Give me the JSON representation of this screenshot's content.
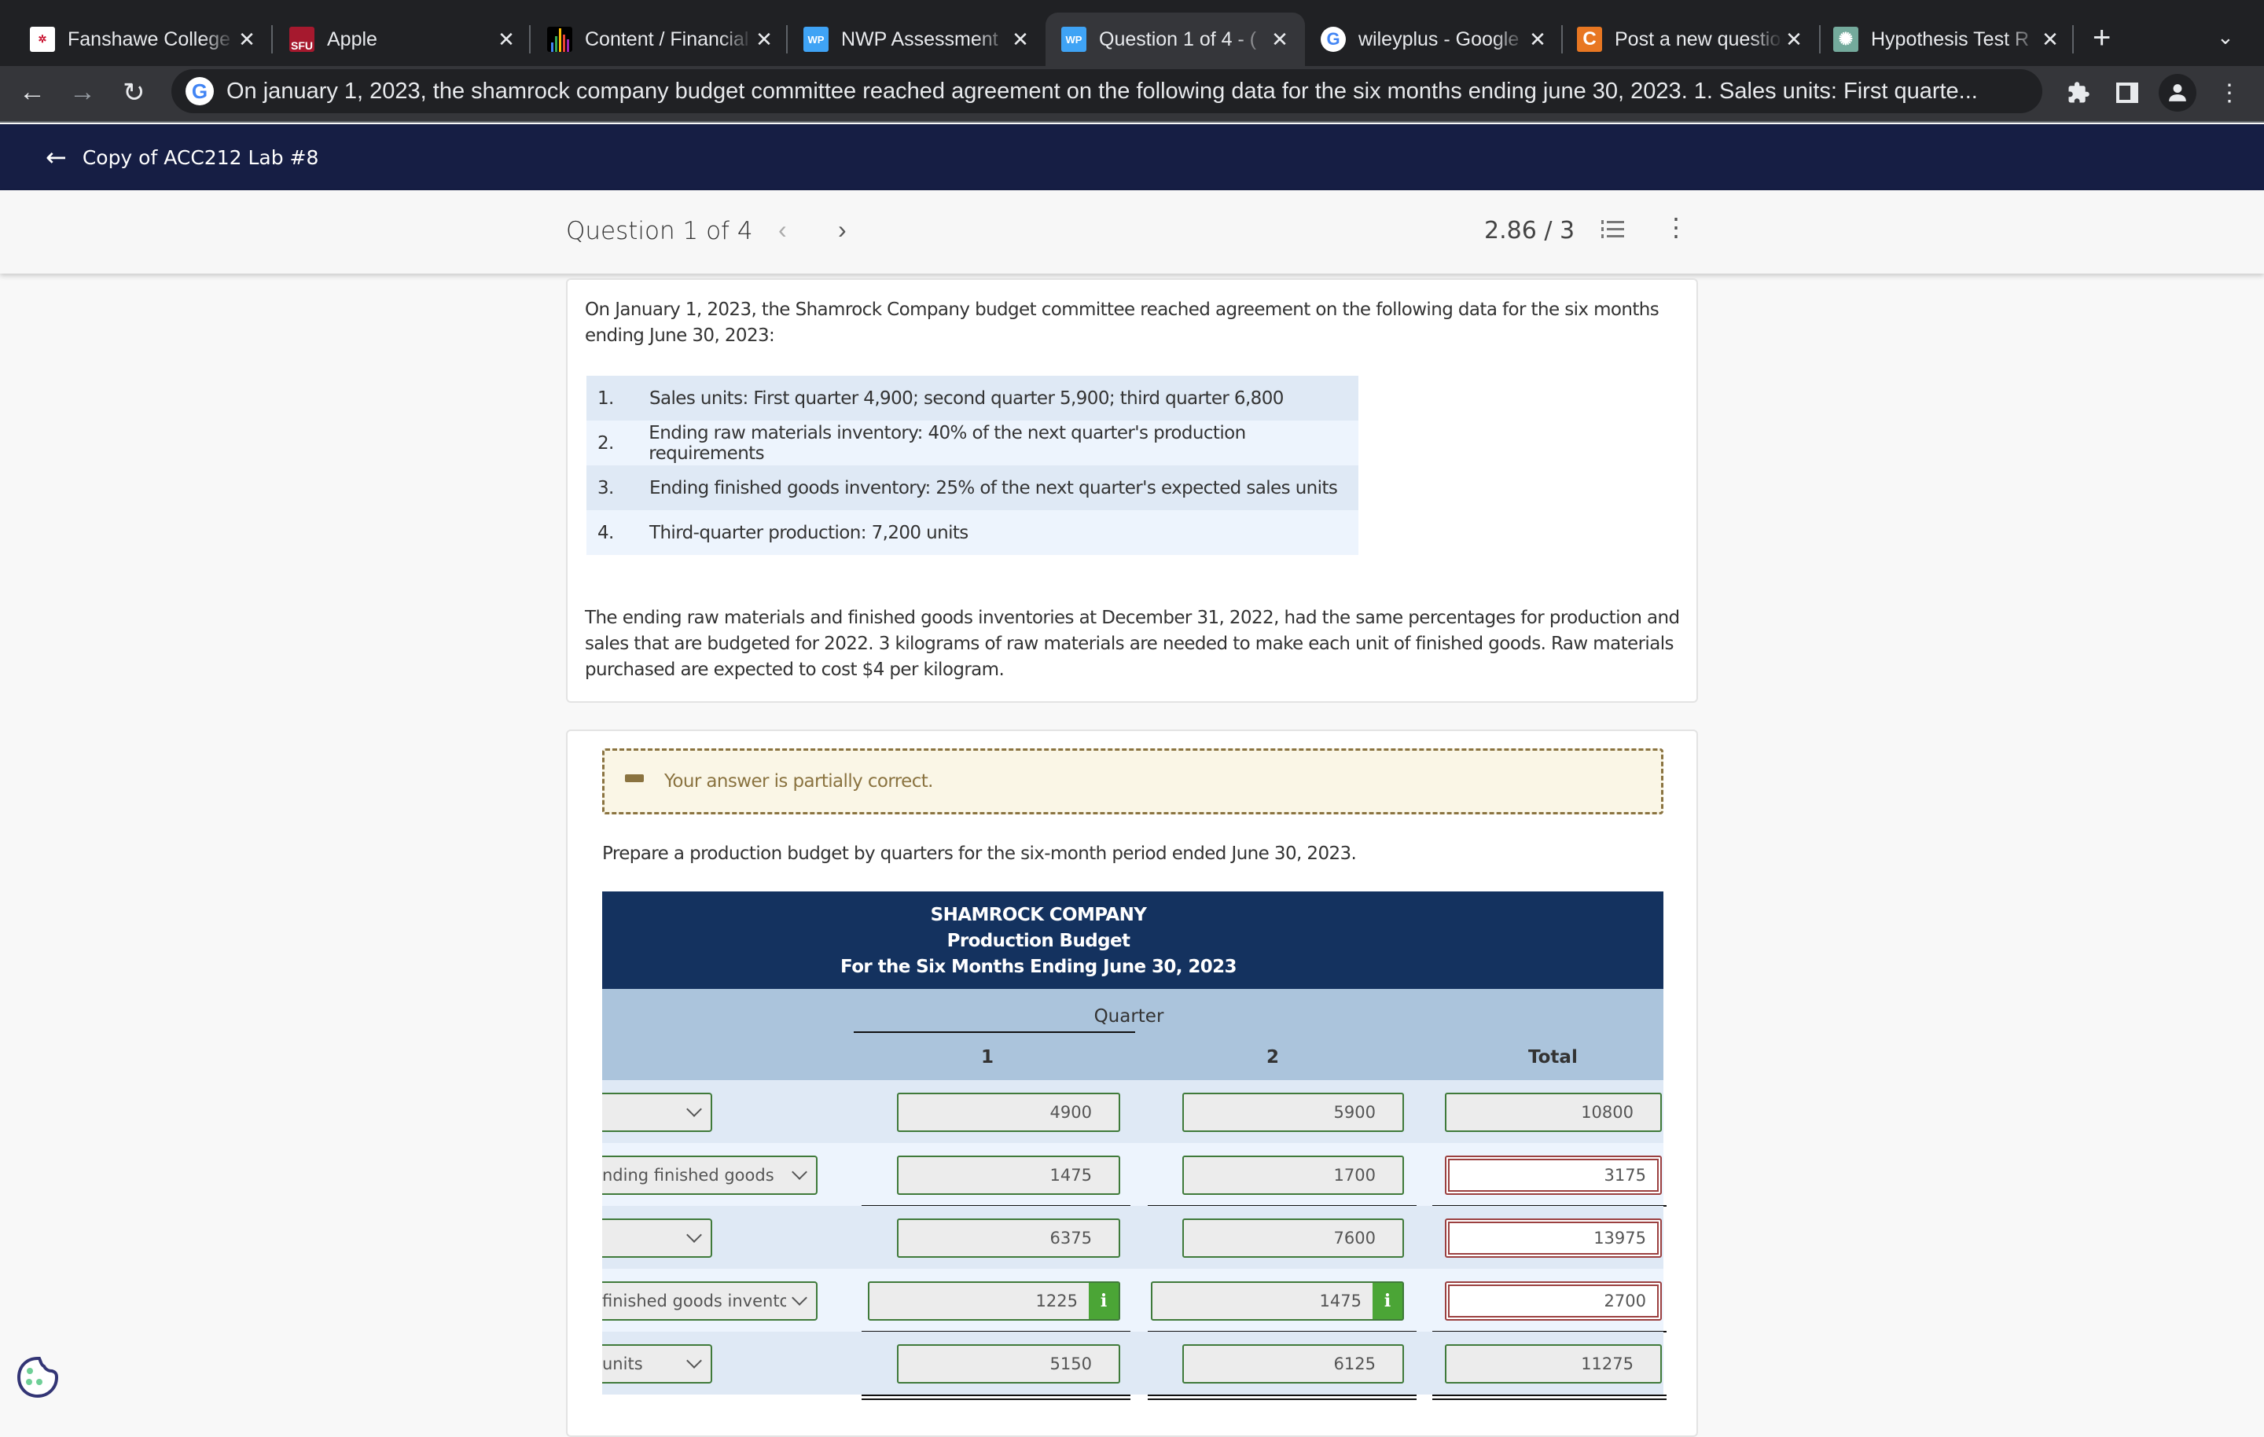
{
  "browser": {
    "tabs": [
      {
        "label": "Fanshawe College",
        "icon": "fanshawe-logo-icon",
        "color": "#c8102e"
      },
      {
        "label": "Apple",
        "icon": "sfu-logo-icon",
        "color": "#a6192e"
      },
      {
        "label": "Content / Financial",
        "icon": "bar-chart-icon",
        "color": "#000000"
      },
      {
        "label": "NWP Assessment",
        "icon": "wp-logo-icon",
        "color": "#3fa3f5"
      },
      {
        "label": "Question 1 of 4 - (",
        "icon": "wp-logo-icon",
        "color": "#3fa3f5",
        "active": true
      },
      {
        "label": "wileyplus - Google",
        "icon": "google-icon",
        "color": "#ffffff"
      },
      {
        "label": "Post a new question",
        "icon": "chegg-icon",
        "color": "#e87722"
      },
      {
        "label": "Hypothesis Test R",
        "icon": "openai-icon",
        "color": "#74aa9c"
      }
    ],
    "new_tab": "+",
    "tab_list": "⌄",
    "back": "←",
    "forward": "→",
    "reload": "C",
    "address": "On january 1, 2023, the shamrock company budget committee reached agreement on the following data for the six months ending june 30, 2023. 1. Sales units: First quarte..."
  },
  "app": {
    "back_label": "Copy of ACC212 Lab #8",
    "question_title": "Question 1 of 4",
    "prev": "‹",
    "next": "›",
    "score": "2.86 / 3",
    "menu": "⋮"
  },
  "problem": {
    "intro": "On January 1, 2023, the Shamrock Company budget committee reached agreement on the following data for the six months ending June 30, 2023:",
    "conditions": [
      {
        "num": "1.",
        "text": "Sales units: First quarter 4,900; second quarter 5,900; third quarter 6,800"
      },
      {
        "num": "2.",
        "text": "Ending raw materials inventory: 40% of the next quarter's production requirements"
      },
      {
        "num": "3.",
        "text": "Ending finished goods inventory: 25% of the next quarter's expected sales units"
      },
      {
        "num": "4.",
        "text": "Third-quarter production: 7,200 units"
      }
    ],
    "notes": "The ending raw materials and finished goods inventories at December 31, 2022, had the same percentages for production and sales that are budgeted for 2022. 3 kilograms of raw materials are needed to make each unit of finished goods. Raw materials purchased are expected to cost $4 per kilogram."
  },
  "answer": {
    "feedback": "Your answer is partially correct.",
    "feedback_color": "#8a7340",
    "instruction": "Prepare a production budget by quarters for the six-month period ended June 30, 2023.",
    "table": {
      "company": "SHAMROCK COMPANY",
      "statement": "Production Budget",
      "period": "For the Six Months Ending June 30, 2023",
      "quarter_label": "Quarter",
      "columns": [
        "1",
        "2",
        "Total"
      ],
      "rows": [
        {
          "label": "",
          "q1": "4900",
          "q2": "5900",
          "total": "10800",
          "total_status": "correct"
        },
        {
          "label": "nding finished goods",
          "q1": "1475",
          "q2": "1700",
          "total": "3175",
          "total_status": "incorrect"
        },
        {
          "label": "",
          "q1": "6375",
          "q2": "7600",
          "total": "13975",
          "total_status": "incorrect"
        },
        {
          "label": "finished goods inventory",
          "q1": "1225",
          "q2": "1475",
          "total": "2700",
          "total_status": "incorrect",
          "has_info": true
        },
        {
          "label": "units",
          "q1": "5150",
          "q2": "6125",
          "total": "11275",
          "total_status": "correct"
        }
      ],
      "info_glyph": "i"
    }
  }
}
